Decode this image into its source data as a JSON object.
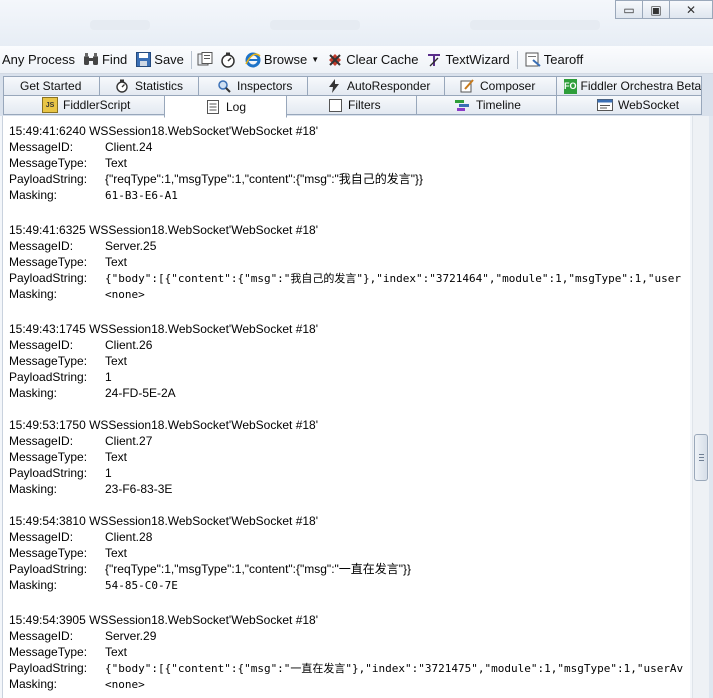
{
  "window": {
    "minimize_glyph": "▭",
    "maximize_glyph": "▣",
    "close_glyph": "✕"
  },
  "toolbar": {
    "any_process": "Any Process",
    "find": "Find",
    "save": "Save",
    "browse": "Browse",
    "clear_cache": "Clear Cache",
    "textwizard": "TextWizard",
    "tearoff": "Tearoff",
    "icons": [
      "crosshair-icon",
      "binoculars-icon",
      "save-icon",
      "snapshot-icon",
      "timer-icon",
      "ie-icon",
      "clear-cache-icon",
      "textwizard-icon",
      "tearoff-icon"
    ]
  },
  "tabs": {
    "row1": [
      "Get Started",
      "Statistics",
      "Inspectors",
      "AutoResponder",
      "Composer",
      "Fiddler Orchestra Beta"
    ],
    "row2": [
      "FiddlerScript",
      "Log",
      "Filters",
      "Timeline",
      "WebSocket"
    ],
    "active": "Log",
    "fo_badge": "FO"
  },
  "log": {
    "keys": [
      "MessageID:",
      "MessageType:",
      "PayloadString:",
      "Masking:"
    ],
    "entries": [
      {
        "header": "15:49:41:6240 WSSession18.WebSocket'WebSocket #18'",
        "id": "Client.24",
        "type": "Text",
        "payload": "{\"reqType\":1,\"msgType\":1,\"content\":{\"msg\":\"我自己的发言\"}}",
        "masking": "61-B3-E6-A1"
      },
      {
        "header": "15:49:41:6325 WSSession18.WebSocket'WebSocket #18'",
        "id": "Server.25",
        "type": "Text",
        "payload": "{\"body\":[{\"content\":{\"msg\":\"我自己的发言\"},\"index\":\"3721464\",\"module\":1,\"msgType\":1,\"user",
        "masking": "<none>"
      },
      {
        "header": "15:49:43:1745 WSSession18.WebSocket'WebSocket #18'",
        "id": "Client.26",
        "type": "Text",
        "payload": "1",
        "masking": "24-FD-5E-2A"
      },
      {
        "header": "15:49:53:1750 WSSession18.WebSocket'WebSocket #18'",
        "id": "Client.27",
        "type": "Text",
        "payload": "1",
        "masking": "23-F6-83-3E"
      },
      {
        "header": "15:49:54:3810 WSSession18.WebSocket'WebSocket #18'",
        "id": "Client.28",
        "type": "Text",
        "payload": "{\"reqType\":1,\"msgType\":1,\"content\":{\"msg\":\"一直在发言\"}}",
        "masking": "54-85-C0-7E"
      },
      {
        "header": "15:49:54:3905 WSSession18.WebSocket'WebSocket #18'",
        "id": "Server.29",
        "type": "Text",
        "payload": "{\"body\":[{\"content\":{\"msg\":\"一直在发言\"},\"index\":\"3721475\",\"module\":1,\"msgType\":1,\"userAv",
        "masking": "<none>"
      }
    ]
  }
}
